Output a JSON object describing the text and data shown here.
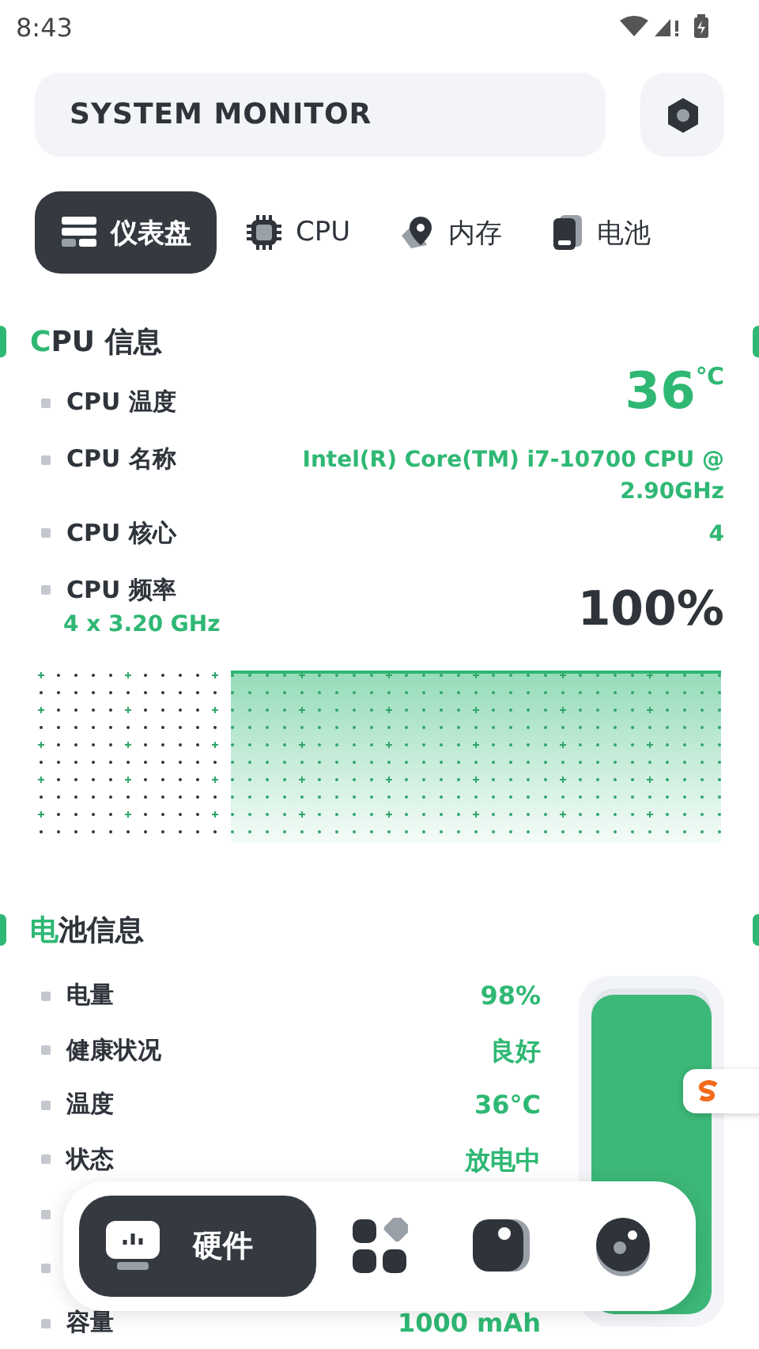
{
  "status_bar": {
    "time": "8:43"
  },
  "header": {
    "title": "SYSTEM MONITOR"
  },
  "tabs": [
    {
      "kind": "dashboard",
      "label": "仪表盘",
      "selected": true
    },
    {
      "kind": "cpu",
      "label": "CPU",
      "selected": false
    },
    {
      "kind": "memory",
      "label": "内存",
      "selected": false
    },
    {
      "kind": "battery",
      "label": "电池",
      "selected": false
    }
  ],
  "cpu": {
    "title_accent": "C",
    "title_rest": "PU 信息",
    "temp_value": "36",
    "temp_unit": "℃",
    "usage": "100%",
    "rows": [
      {
        "label": "CPU 温度"
      },
      {
        "label": "CPU 名称",
        "value": "Intel(R) Core(TM) i7-10700 CPU @ 2.90GHz"
      },
      {
        "label": "CPU 核心",
        "value": "4"
      },
      {
        "label": "CPU 频率",
        "sub": "4 x 3.20 GHz"
      }
    ]
  },
  "battery": {
    "title_accent": "电",
    "title_rest": "池信息",
    "level": 0.98,
    "rows": [
      {
        "kind": "row",
        "label": "电量",
        "value": "98%"
      },
      {
        "kind": "row",
        "label": "健康状况",
        "value": "良好"
      },
      {
        "kind": "row",
        "label": "温度",
        "value": "36°C"
      },
      {
        "kind": "row",
        "label": "状态",
        "value": "放电中"
      },
      {
        "kind": "covered"
      },
      {
        "kind": "covered"
      },
      {
        "kind": "row",
        "label": "容量",
        "value": "1000 mAh"
      }
    ]
  },
  "bottom_nav": [
    {
      "kind": "hardware",
      "label": "硬件",
      "selected": true
    },
    {
      "kind": "apps",
      "selected": false
    },
    {
      "kind": "sensor",
      "selected": false
    },
    {
      "kind": "tools",
      "selected": false
    }
  ]
}
